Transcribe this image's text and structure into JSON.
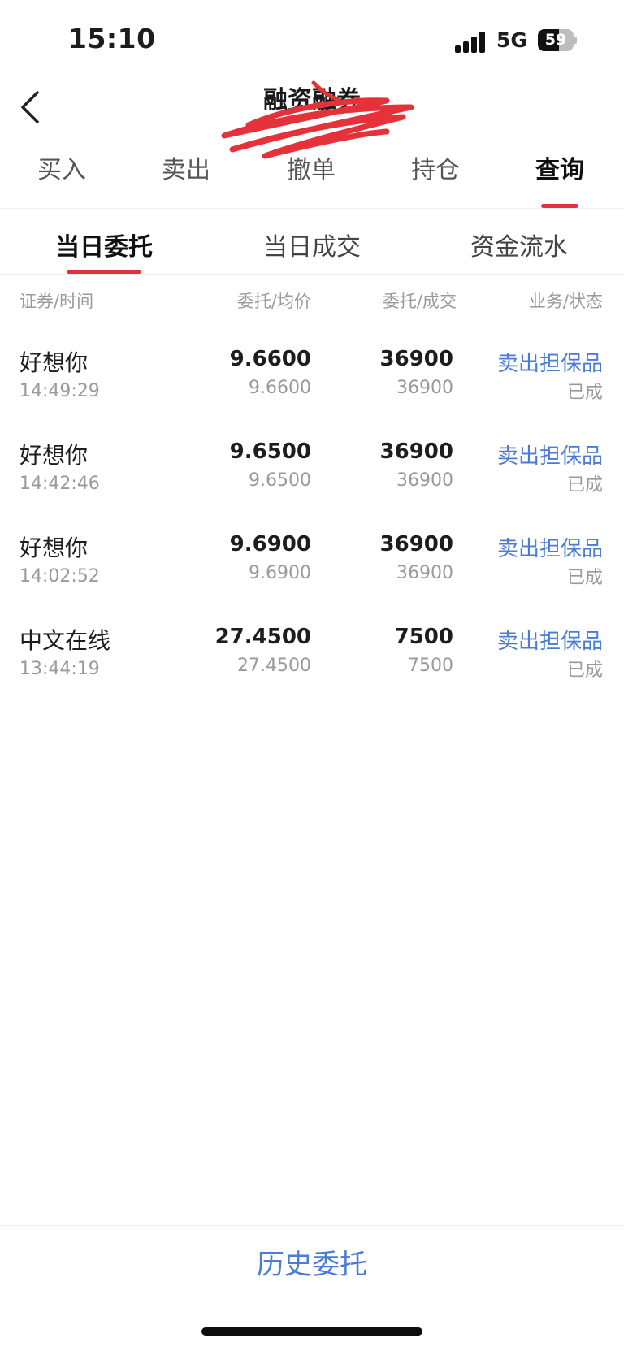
{
  "status": {
    "time": "15:10",
    "network": "5G",
    "battery": "59",
    "battery_level": 0.59
  },
  "header": {
    "title": "融资融券"
  },
  "main_tabs": [
    {
      "label": "买入"
    },
    {
      "label": "卖出"
    },
    {
      "label": "撤单"
    },
    {
      "label": "持仓"
    },
    {
      "label": "查询",
      "active": true
    }
  ],
  "sub_tabs": [
    {
      "label": "当日委托",
      "active": true
    },
    {
      "label": "当日成交"
    },
    {
      "label": "资金流水"
    }
  ],
  "table": {
    "headers": [
      "证券/时间",
      "委托/均价",
      "委托/成交",
      "业务/状态"
    ],
    "rows": [
      {
        "name": "好想你",
        "time": "14:49:29",
        "price": "9.6600",
        "avg": "9.6600",
        "qty": "36900",
        "filled": "36900",
        "biz": "卖出担保品",
        "status": "已成"
      },
      {
        "name": "好想你",
        "time": "14:42:46",
        "price": "9.6500",
        "avg": "9.6500",
        "qty": "36900",
        "filled": "36900",
        "biz": "卖出担保品",
        "status": "已成"
      },
      {
        "name": "好想你",
        "time": "14:02:52",
        "price": "9.6900",
        "avg": "9.6900",
        "qty": "36900",
        "filled": "36900",
        "biz": "卖出担保品",
        "status": "已成"
      },
      {
        "name": "中文在线",
        "time": "13:44:19",
        "price": "27.4500",
        "avg": "27.4500",
        "qty": "7500",
        "filled": "7500",
        "biz": "卖出担保品",
        "status": "已成"
      }
    ]
  },
  "footer": {
    "history_label": "历史委托"
  },
  "colors": {
    "accent_red": "#e0323c",
    "link_blue": "#4a7bd6"
  }
}
